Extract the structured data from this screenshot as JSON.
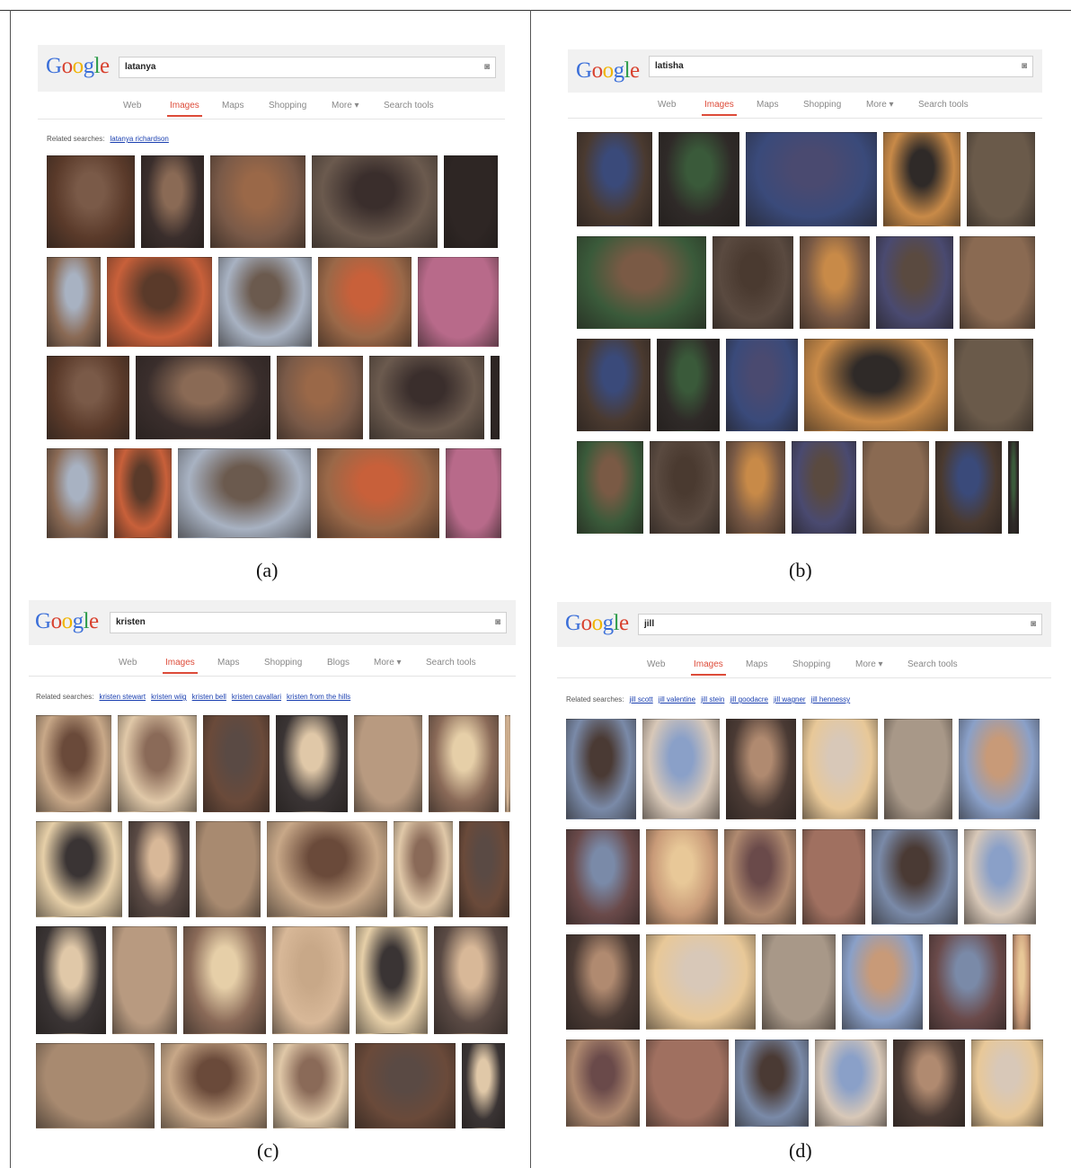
{
  "panels": [
    {
      "id": "a",
      "caption": "(a)",
      "query": "latanya",
      "tabs": [
        "Web",
        "Images",
        "Maps",
        "Shopping",
        "More ▾",
        "Search tools"
      ],
      "active_tab": 1,
      "related_label": "Related searches:",
      "related": [
        "latanya richardson"
      ]
    },
    {
      "id": "b",
      "caption": "(b)",
      "query": "latisha",
      "tabs": [
        "Web",
        "Images",
        "Maps",
        "Shopping",
        "More ▾",
        "Search tools"
      ],
      "active_tab": 1,
      "related_label": "",
      "related": []
    },
    {
      "id": "c",
      "caption": "(c)",
      "query": "kristen",
      "tabs": [
        "Web",
        "Images",
        "Maps",
        "Shopping",
        "Blogs",
        "More ▾",
        "Search tools"
      ],
      "active_tab": 1,
      "related_label": "Related searches:",
      "related": [
        "kristen stewart",
        "kristen wiig",
        "kristen bell",
        "kristen cavallari",
        "kristen from the hills"
      ]
    },
    {
      "id": "d",
      "caption": "(d)",
      "query": "jill",
      "tabs": [
        "Web",
        "Images",
        "Maps",
        "Shopping",
        "More ▾",
        "Search tools"
      ],
      "active_tab": 1,
      "related_label": "Related searches:",
      "related": [
        "jill scott",
        "jill valentine",
        "jill stein",
        "jill goodacre",
        "jill wagner",
        "jill hennessy"
      ]
    }
  ],
  "colors": {
    "logo": [
      "#3b6fd9",
      "#d8412e",
      "#f0b400",
      "#3b6fd9",
      "#2e9c4a",
      "#d8412e"
    ],
    "active_tab": "#dd4b39",
    "link": "#1a3fb0"
  }
}
